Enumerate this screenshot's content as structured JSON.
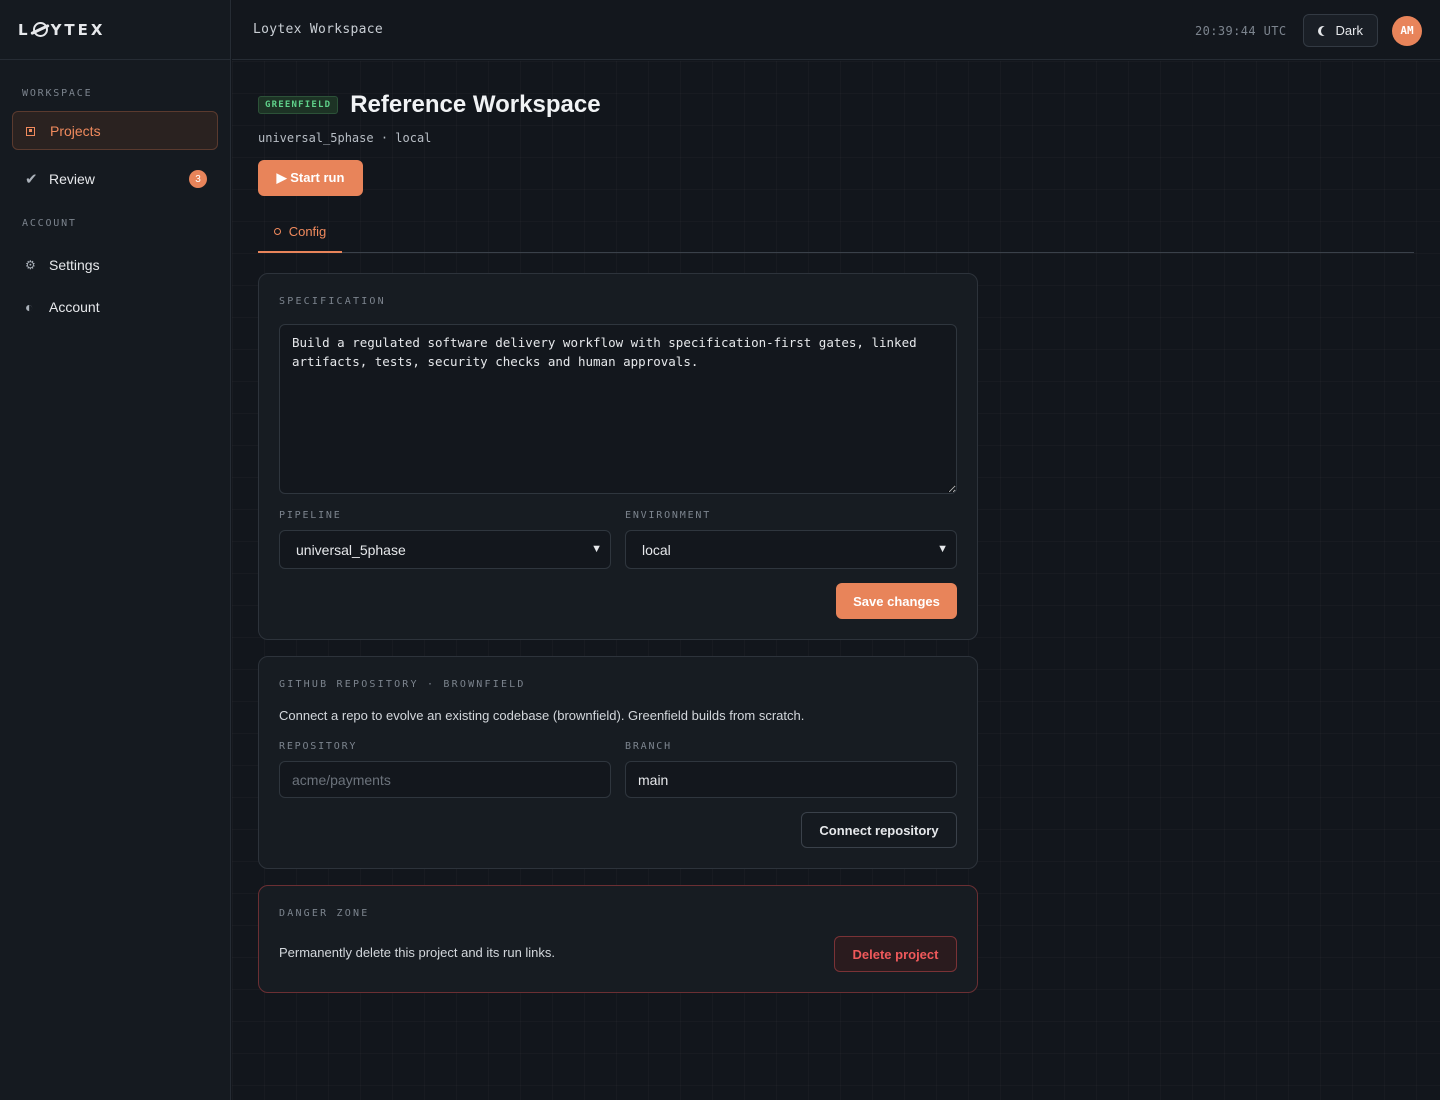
{
  "app": {
    "logo_text_left": "L",
    "logo_text_right": "YTEX",
    "workspace_title": "Loytex Workspace",
    "clock": "20:39:44 UTC",
    "theme_label": "Dark",
    "avatar_initials": "AM",
    "accent_color": "#e8845a"
  },
  "sidebar": {
    "sections": [
      {
        "title": "WORKSPACE",
        "items": [
          {
            "label": "Projects",
            "icon": "projects-icon",
            "active": true
          },
          {
            "label": "Review",
            "icon": "check-icon",
            "badge": "3"
          }
        ]
      },
      {
        "title": "ACCOUNT",
        "items": [
          {
            "label": "Settings",
            "icon": "gear-icon"
          },
          {
            "label": "Account",
            "icon": "half-circle-icon"
          }
        ]
      }
    ]
  },
  "project": {
    "tag": "GREENFIELD",
    "title": "Reference Workspace",
    "subtitle": "universal_5phase · local",
    "start_run_label": "▶ Start run",
    "tabs": [
      {
        "label": "Config",
        "active": true
      }
    ]
  },
  "spec_card": {
    "label": "SPECIFICATION",
    "spec_text": "Build a regulated software delivery workflow with specification-first gates, linked artifacts, tests, security checks and human approvals.",
    "pipeline_label": "PIPELINE",
    "pipeline_value": "universal_5phase",
    "environment_label": "ENVIRONMENT",
    "environment_value": "local",
    "save_label": "Save changes"
  },
  "repo_card": {
    "label": "GITHUB REPOSITORY · BROWNFIELD",
    "description": "Connect a repo to evolve an existing codebase (brownfield). Greenfield builds from scratch.",
    "repository_label": "REPOSITORY",
    "repository_placeholder": "acme/payments",
    "repository_value": "",
    "branch_label": "BRANCH",
    "branch_value": "main",
    "connect_label": "Connect repository"
  },
  "danger_card": {
    "label": "DANGER ZONE",
    "description": "Permanently delete this project and its run links.",
    "delete_label": "Delete project"
  }
}
